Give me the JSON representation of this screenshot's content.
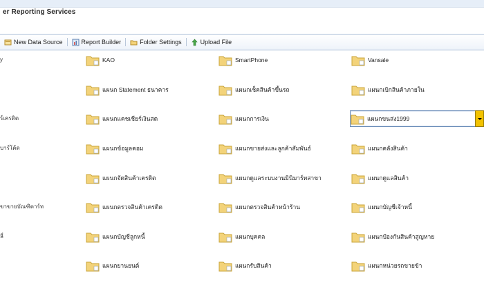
{
  "header": {
    "title": "er Reporting Services"
  },
  "toolbar": {
    "buttons": [
      {
        "label": "New Data Source",
        "icon": "data-source-icon"
      },
      {
        "label": "Report Builder",
        "icon": "report-builder-icon"
      },
      {
        "label": "Folder Settings",
        "icon": "folder-settings-icon"
      },
      {
        "label": "Upload File",
        "icon": "upload-arrow-icon"
      }
    ]
  },
  "left_column": [
    "y",
    "ร์เครดิต",
    "บาร์โค้ด",
    "ขาขายบัณฑิตาร์ท",
    "ลี่"
  ],
  "folders": [
    "KAO",
    "SmartPhone",
    "Vansale",
    "แผนก Statement ธนาคาร",
    "แผนกเช็คสินค้าขึ้นรถ",
    "แผนกเบิกสินค้าภายใน",
    "แผนกแคชเชียร์เงินสด",
    "แผนกการเงิน",
    "แผนกขนส่ง1999",
    "แผนกข้อมูลคอม",
    "แผนกขายส่งและลูกค้าสัมพันธ์",
    "แผนกคลังสินค้า",
    "แผนกจัดสินค้าเครดิต",
    "แผนกดูแลระบบงานมินิมาร์ทสาขา",
    "แผนกดูแลสินค้า",
    "แผนกตรวจสินค้าเครดิต",
    "แผนกตรวจสินค้าหน้าร้าน",
    "แผนกบัญชีเจ้าหนี้",
    "แผนกบัญชีลูกหนี้",
    "แผนกบุคคล",
    "แผนกป้องกันสินค้าสูญหาย",
    "แผนกยานยนต์",
    "แผนกรับสินค้า",
    "แผนกหน่วยรถขายข้า"
  ],
  "selected_folder": "แผนกขนส่ง1999",
  "colors": {
    "folder": "#f3d37a",
    "folder_border": "#c9a43b",
    "toolbar_border": "#a7bcd6",
    "selection_button": "#f2c200"
  }
}
